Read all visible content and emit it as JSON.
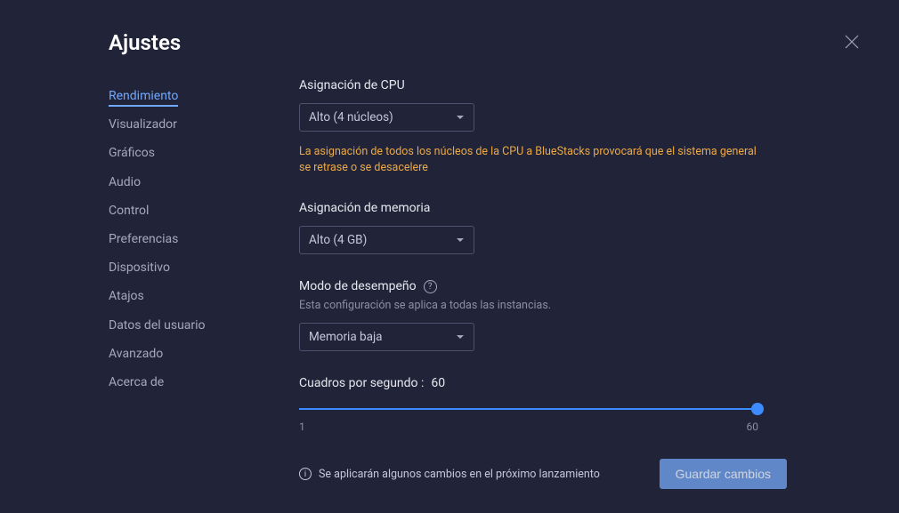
{
  "title": "Ajustes",
  "sidebar": {
    "items": [
      {
        "label": "Rendimiento",
        "active": true
      },
      {
        "label": "Visualizador"
      },
      {
        "label": "Gráficos"
      },
      {
        "label": "Audio"
      },
      {
        "label": "Control"
      },
      {
        "label": "Preferencias"
      },
      {
        "label": "Dispositivo"
      },
      {
        "label": "Atajos"
      },
      {
        "label": "Datos del usuario"
      },
      {
        "label": "Avanzado"
      },
      {
        "label": "Acerca de"
      }
    ]
  },
  "cpu": {
    "label": "Asignación de CPU",
    "value": "Alto (4 núcleos)",
    "warning": "La asignación de todos los núcleos de la CPU a BlueStacks provocará que el sistema general se retrase o se desacelere"
  },
  "memory": {
    "label": "Asignación de memoria",
    "value": "Alto (4 GB)"
  },
  "perf_mode": {
    "label": "Modo de desempeño",
    "sublabel": "Esta configuración se aplica a todas las instancias.",
    "value": "Memoria baja"
  },
  "fps": {
    "label_prefix": "Cuadros por segundo : ",
    "value": "60",
    "min": "1",
    "max": "60"
  },
  "footer": {
    "note": "Se aplicarán algunos cambios en el próximo lanzamiento",
    "save": "Guardar cambios"
  }
}
